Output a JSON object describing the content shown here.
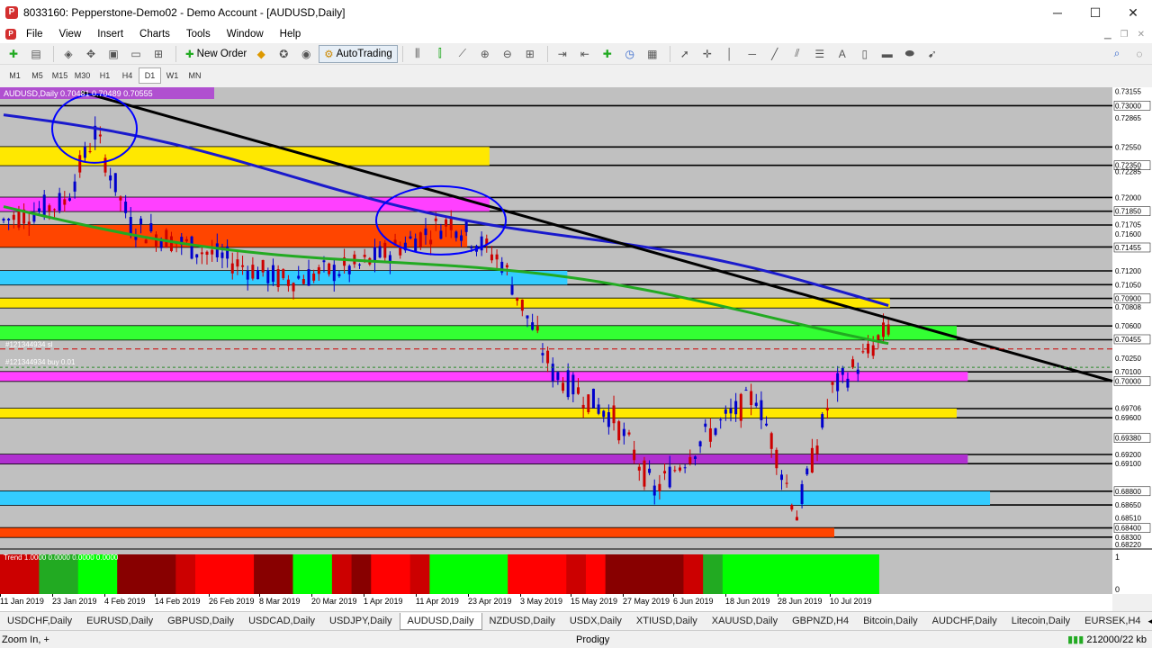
{
  "window": {
    "title": "8033160: Pepperstone-Demo02 - Demo Account - [AUDUSD,Daily]",
    "minimize": "─",
    "maximize": "☐",
    "close": "✕"
  },
  "menu": [
    "File",
    "View",
    "Insert",
    "Charts",
    "Tools",
    "Window",
    "Help"
  ],
  "toolbar": {
    "new_order": "New Order",
    "autotrading": "AutoTrading"
  },
  "timeframes": [
    "M1",
    "M5",
    "M15",
    "M30",
    "H1",
    "H4",
    "D1",
    "W1",
    "MN"
  ],
  "active_timeframe": "D1",
  "chart": {
    "symbol_info": "AUDUSD,Daily 0.70481 0.70489 0.70555",
    "order_label_1": "#121344934 sl",
    "order_label_2": "#121344934 buy 0.01",
    "indicator_label": "Trend 1.0000 0.0000 0.0000 0.0000",
    "indicator_scale_top": "1",
    "indicator_scale_bottom": "0"
  },
  "chart_data": {
    "type": "candlestick",
    "price_scale": [
      "0.73155",
      "0.73000",
      "0.72865",
      "0.72550",
      "0.72350",
      "0.72285",
      "0.72000",
      "0.71850",
      "0.71705",
      "0.71600",
      "0.71455",
      "0.71200",
      "0.71050",
      "0.70900",
      "0.70808",
      "0.70600",
      "0.70455",
      "0.70250",
      "0.70100",
      "0.70000",
      "0.69706",
      "0.69600",
      "0.69380",
      "0.69200",
      "0.69100",
      "0.68800",
      "0.68650",
      "0.68510",
      "0.68400",
      "0.68300",
      "0.68220"
    ],
    "dates": [
      "11 Jan 2019",
      "23 Jan 2019",
      "4 Feb 2019",
      "14 Feb 2019",
      "26 Feb 2019",
      "8 Mar 2019",
      "20 Mar 2019",
      "1 Apr 2019",
      "11 Apr 2019",
      "23 Apr 2019",
      "3 May 2019",
      "15 May 2019",
      "27 May 2019",
      "6 Jun 2019",
      "18 Jun 2019",
      "28 Jun 2019",
      "10 Jul 2019"
    ],
    "zones": [
      {
        "price_top": 0.7255,
        "price_bottom": 0.7235,
        "color": "#ffe800",
        "extent": 0.44
      },
      {
        "price_top": 0.72,
        "price_bottom": 0.7185,
        "color": "#ff40ff",
        "extent": 0.44
      },
      {
        "price_top": 0.717,
        "price_bottom": 0.7146,
        "color": "#ff4500",
        "extent": 0.42
      },
      {
        "price_top": 0.712,
        "price_bottom": 0.7105,
        "color": "#33ccff",
        "extent": 0.51
      },
      {
        "price_top": 0.709,
        "price_bottom": 0.708,
        "color": "#ffe800",
        "extent": 0.8
      },
      {
        "price_top": 0.706,
        "price_bottom": 0.7045,
        "color": "#33ff33",
        "extent": 0.86
      },
      {
        "price_top": 0.701,
        "price_bottom": 0.7,
        "color": "#ff40ff",
        "extent": 0.87
      },
      {
        "price_top": 0.697,
        "price_bottom": 0.696,
        "color": "#ffe800",
        "extent": 0.86
      },
      {
        "price_top": 0.692,
        "price_bottom": 0.691,
        "color": "#b030d0",
        "extent": 0.87
      },
      {
        "price_top": 0.688,
        "price_bottom": 0.6865,
        "color": "#33ccff",
        "extent": 0.89
      },
      {
        "price_top": 0.684,
        "price_bottom": 0.683,
        "color": "#ff4500",
        "extent": 0.75
      }
    ],
    "indicator_colors": [
      "#cc0000",
      "#ff0000",
      "#22aa22",
      "#00ff00",
      "#880000"
    ]
  },
  "symbol_tabs": [
    "USDCHF,Daily",
    "EURUSD,Daily",
    "GBPUSD,Daily",
    "USDCAD,Daily",
    "USDJPY,Daily",
    "AUDUSD,Daily",
    "NZDUSD,Daily",
    "USDX,Daily",
    "XTIUSD,Daily",
    "XAUUSD,Daily",
    "GBPNZD,H4",
    "Bitcoin,Daily",
    "AUDCHF,Daily",
    "Litecoin,Daily",
    "EURSEK,H4"
  ],
  "active_tab": "AUDUSD,Daily",
  "status": {
    "left": "Zoom In, +",
    "middle": "Prodigy",
    "right": "212000/22 kb"
  }
}
